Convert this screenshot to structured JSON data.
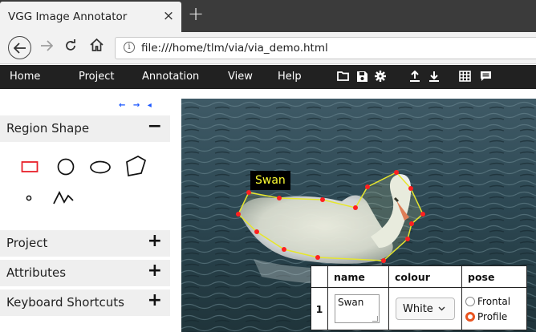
{
  "browser": {
    "tab_title": "VGG Image Annotator",
    "tab_close": "×",
    "new_tab": "+",
    "url": "file:///home/tlm/via/via_demo.html"
  },
  "menu": {
    "items": [
      "Home",
      "Project",
      "Annotation",
      "View",
      "Help"
    ],
    "toolbar_icons": [
      "folder-icon",
      "save-icon",
      "settings-icon",
      "upload-icon",
      "download-icon",
      "grid-view-icon",
      "list-view-icon"
    ]
  },
  "sidebar": {
    "nav_arrows": "← → ◂",
    "region_shape": {
      "label": "Region Shape",
      "toggle": "−"
    },
    "shapes": [
      "rectangle",
      "circle",
      "ellipse",
      "polygon",
      "point",
      "polyline"
    ],
    "selected_shape": "rectangle",
    "sections": [
      {
        "label": "Project",
        "toggle": "+"
      },
      {
        "label": "Attributes",
        "toggle": "+"
      },
      {
        "label": "Keyboard Shortcuts",
        "toggle": "+"
      }
    ]
  },
  "canvas": {
    "region_label": "Swan",
    "region_color": "#e6e62e",
    "vertex_color": "#ff2020"
  },
  "annotation_editor": {
    "headers": [
      "name",
      "colour",
      "pose"
    ],
    "row_index": "1",
    "name_value": "Swan",
    "colour_value": "White",
    "pose_options": [
      "Frontal",
      "Profile"
    ],
    "pose_selected": "Profile"
  },
  "colors": {
    "menubar_bg": "#212121",
    "accent": "#e95420",
    "panel_header_bg": "#efefef"
  }
}
